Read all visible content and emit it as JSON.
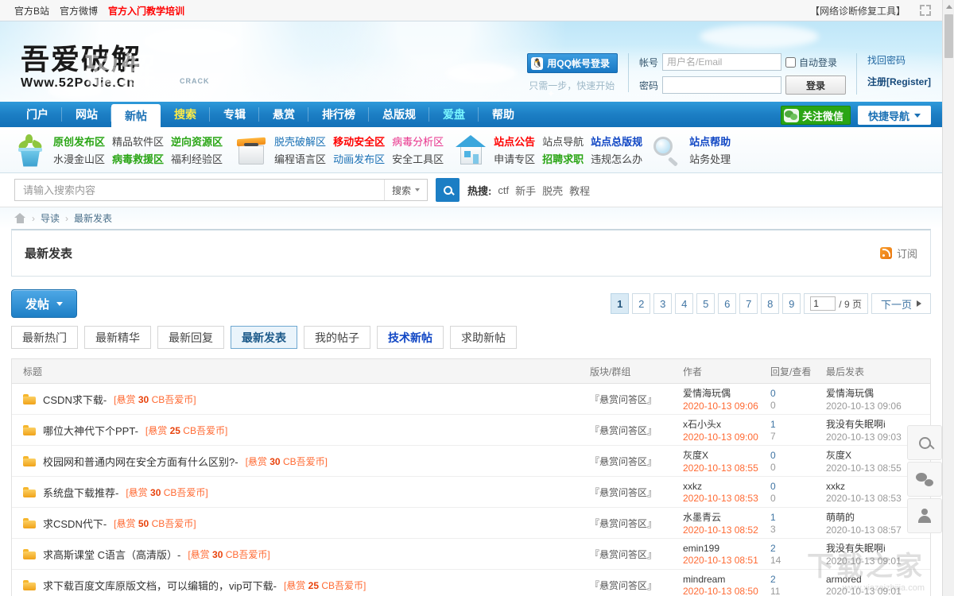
{
  "topbar": {
    "links": [
      {
        "label": "官方B站",
        "hot": false
      },
      {
        "label": "官方微博",
        "hot": false
      },
      {
        "label": "官方入门教学培训",
        "hot": true
      }
    ],
    "tool_label": "【网络诊断修复工具】"
  },
  "header": {
    "logo_cn": "吾爱破解",
    "logo_en": "Www.52PoJie.Cn",
    "logo_ghost": "破解",
    "logo_crack": "CRACK",
    "qq_login_label": "用QQ帐号登录",
    "qq_sub_label": "只需一步，快速开始",
    "account_label": "帐号",
    "account_placeholder": "用户名/Email",
    "account_value": "",
    "password_label": "密码",
    "password_value": "",
    "auto_login_label": "自动登录",
    "login_button": "登录",
    "find_password": "找回密码",
    "register": "注册[Register]"
  },
  "mainnav": {
    "items": [
      {
        "label": "门户",
        "state": "normal"
      },
      {
        "label": "网站",
        "state": "normal"
      },
      {
        "label": "新帖",
        "state": "active"
      },
      {
        "label": "搜索",
        "state": "yellow"
      },
      {
        "label": "专辑",
        "state": "normal"
      },
      {
        "label": "悬赏",
        "state": "normal"
      },
      {
        "label": "排行榜",
        "state": "normal"
      },
      {
        "label": "总版规",
        "state": "normal"
      },
      {
        "label": "爱盘",
        "state": "cyan"
      },
      {
        "label": "帮助",
        "state": "normal"
      }
    ],
    "wechat_label": "关注微信",
    "quicknav_label": "快捷导航"
  },
  "subnav": {
    "groups": [
      {
        "icon": "plant-icon",
        "links": [
          {
            "label": "原创发布区",
            "color": "g"
          },
          {
            "label": "精品软件区",
            "color": "default"
          },
          {
            "label": "逆向资源区",
            "color": "g"
          },
          {
            "label": "水漫金山区",
            "color": "default"
          },
          {
            "label": "病毒救援区",
            "color": "g"
          },
          {
            "label": "福利经验区",
            "color": "default"
          }
        ]
      },
      {
        "icon": "box-icon",
        "links": [
          {
            "label": "脱壳破解区",
            "color": "blue2"
          },
          {
            "label": "移动安全区",
            "color": "r"
          },
          {
            "label": "病毒分析区",
            "color": "pink"
          },
          {
            "label": "编程语言区",
            "color": "default"
          },
          {
            "label": "动画发布区",
            "color": "blue2"
          },
          {
            "label": "安全工具区",
            "color": "default"
          }
        ]
      },
      {
        "icon": "house-icon",
        "links": [
          {
            "label": "站点公告",
            "color": "r"
          },
          {
            "label": "站点导航",
            "color": "default"
          },
          {
            "label": "站点总版规",
            "color": "b"
          },
          {
            "label": "申请专区",
            "color": "default"
          },
          {
            "label": "招聘求职",
            "color": "g"
          },
          {
            "label": "违规怎么办",
            "color": "default"
          }
        ]
      },
      {
        "icon": "magnifier-icon",
        "links": [
          {
            "label": "站点帮助",
            "color": "b"
          },
          {
            "label": "站务处理",
            "color": "default"
          }
        ]
      }
    ]
  },
  "search": {
    "placeholder": "请输入搜索内容",
    "value": "",
    "scope_label": "搜索",
    "hot_label": "热搜:",
    "hot_items": [
      "ctf",
      "新手",
      "脱壳",
      "教程"
    ]
  },
  "breadcrumb": {
    "items": [
      "导读",
      "最新发表"
    ]
  },
  "content": {
    "title": "最新发表",
    "subscribe_label": "订阅"
  },
  "toolbar": {
    "post_label": "发帖"
  },
  "pager": {
    "current": "1",
    "pages": [
      "1",
      "2",
      "3",
      "4",
      "5",
      "6",
      "7",
      "8",
      "9"
    ],
    "jump_value": "1",
    "jump_suffix": "/ 9 页",
    "next_label": "下一页"
  },
  "filter_tabs": [
    {
      "label": "最新热门",
      "state": "normal"
    },
    {
      "label": "最新精华",
      "state": "normal"
    },
    {
      "label": "最新回复",
      "state": "normal"
    },
    {
      "label": "最新发表",
      "state": "active"
    },
    {
      "label": "我的帖子",
      "state": "normal"
    },
    {
      "label": "技术新帖",
      "state": "highlight"
    },
    {
      "label": "求助新帖",
      "state": "normal"
    }
  ],
  "table": {
    "headers": {
      "title": "标题",
      "forum": "版块/群组",
      "author": "作者",
      "reply": "回复/查看",
      "last": "最后发表"
    },
    "rows": [
      {
        "title": "CSDN求下载-",
        "bounty_prefix": "[悬赏",
        "bounty_amount": "30",
        "bounty_suffix": "CB吾爱币]",
        "forum": "『悬赏问答区』",
        "author": "爱情海玩偶",
        "author_date": "2020-10-13 09:06",
        "replies": "0",
        "views": "0",
        "last_author": "爱情海玩偶",
        "last_date": "2020-10-13 09:06"
      },
      {
        "title": "哪位大神代下个PPT-",
        "bounty_prefix": "[悬赏",
        "bounty_amount": "25",
        "bounty_suffix": "CB吾爱币]",
        "forum": "『悬赏问答区』",
        "author": "x石小头x",
        "author_date": "2020-10-13 09:00",
        "replies": "1",
        "views": "7",
        "last_author": "我没有失眠啊i",
        "last_date": "2020-10-13 09:03"
      },
      {
        "title": "校园网和普通内网在安全方面有什么区别?-",
        "bounty_prefix": "[悬赏",
        "bounty_amount": "30",
        "bounty_suffix": "CB吾爱币]",
        "forum": "『悬赏问答区』",
        "author": "灰度X",
        "author_date": "2020-10-13 08:55",
        "replies": "0",
        "views": "0",
        "last_author": "灰度X",
        "last_date": "2020-10-13 08:55"
      },
      {
        "title": "系统盘下载推荐-",
        "bounty_prefix": "[悬赏",
        "bounty_amount": "30",
        "bounty_suffix": "CB吾爱币]",
        "forum": "『悬赏问答区』",
        "author": "xxkz",
        "author_date": "2020-10-13 08:53",
        "replies": "0",
        "views": "0",
        "last_author": "xxkz",
        "last_date": "2020-10-13 08:53"
      },
      {
        "title": "求CSDN代下-",
        "bounty_prefix": "[悬赏",
        "bounty_amount": "50",
        "bounty_suffix": "CB吾爱币]",
        "forum": "『悬赏问答区』",
        "author": "水墨青云",
        "author_date": "2020-10-13 08:52",
        "replies": "1",
        "views": "3",
        "last_author": "萌萌的",
        "last_date": "2020-10-13 08:57"
      },
      {
        "title": "求高斯课堂 C语言（高清版）-",
        "bounty_prefix": "[悬赏",
        "bounty_amount": "30",
        "bounty_suffix": "CB吾爱币]",
        "forum": "『悬赏问答区』",
        "author": "emin199",
        "author_date": "2020-10-13 08:51",
        "replies": "2",
        "views": "14",
        "last_author": "我没有失眠啊i",
        "last_date": "2020-10-13 09:01"
      },
      {
        "title": "求下载百度文库原版文档，可以编辑的，vip可下载-",
        "bounty_prefix": "[悬赏",
        "bounty_amount": "25",
        "bounty_suffix": "CB吾爱币]",
        "forum": "『悬赏问答区』",
        "author": "mindream",
        "author_date": "2020-10-13 08:50",
        "replies": "2",
        "views": "11",
        "last_author": "armored",
        "last_date": "2020-10-13 09:01"
      }
    ]
  },
  "sidewidget": {
    "items": [
      "search-icon",
      "chat-icon",
      "person-icon"
    ]
  },
  "watermark": {
    "text": "下载之家",
    "sub": "www.xiazaizhijia.com"
  }
}
